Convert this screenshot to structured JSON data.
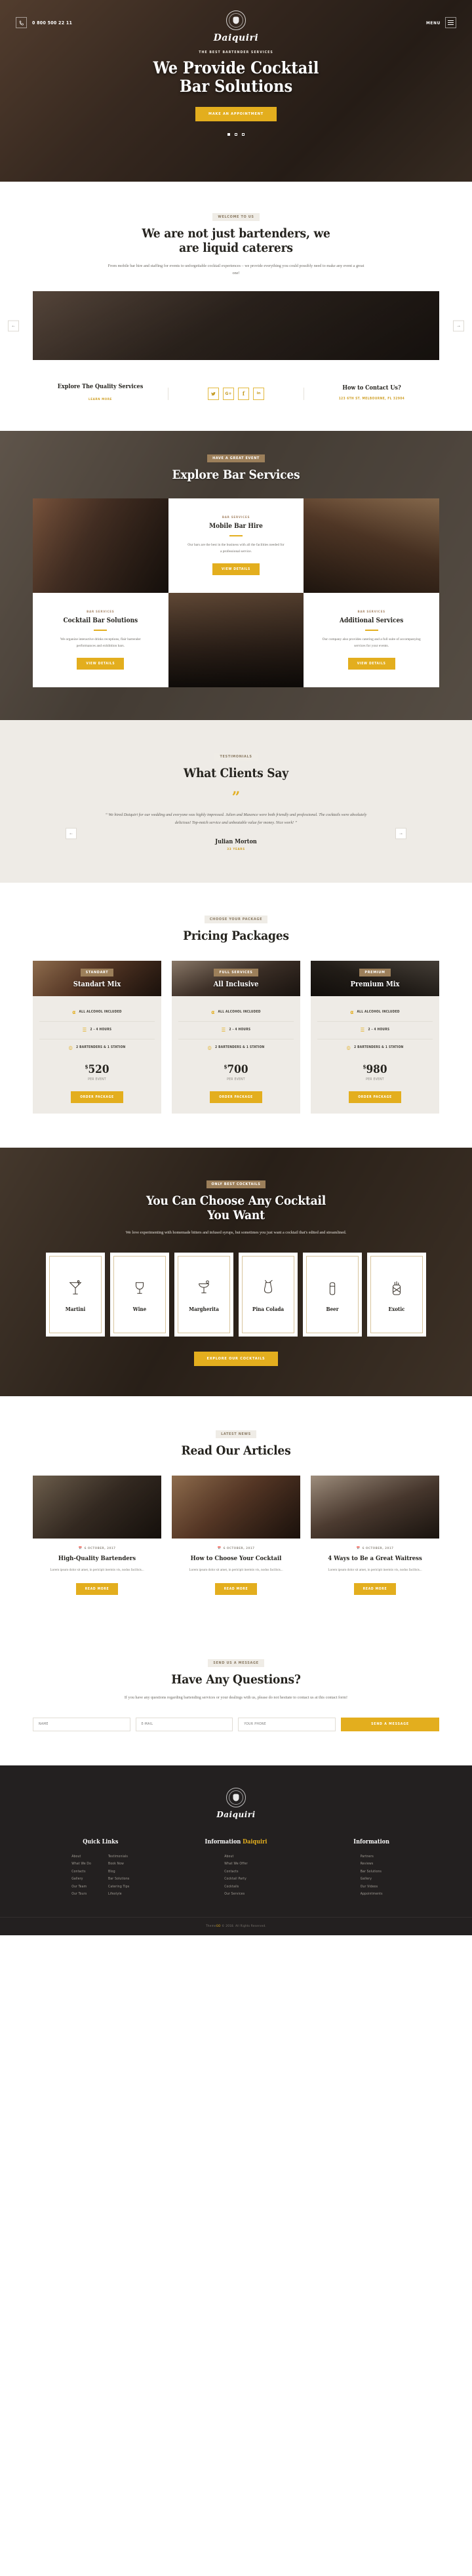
{
  "brand": {
    "name": "Daiquiri",
    "mark_icon": "shaker-emblem-icon"
  },
  "header": {
    "phone_icon": "phone-icon",
    "phone": "0 800 500 22 11",
    "menu_label": "MENU",
    "menu_icon": "hamburger-icon"
  },
  "hero": {
    "eyebrow": "THE BEST BARTENDER SERVICES",
    "title_line1": "We Provide Cocktail",
    "title_line2": "Bar Solutions",
    "cta": "MAKE AN APPOINTMENT",
    "slides": 3,
    "active_slide": 1
  },
  "about": {
    "badge": "WELCOME TO US",
    "title_line1": "We are not just bartenders, we",
    "title_line2": "are liquid caterers",
    "lead": "From mobile bar hire and staffing for events to unforgettable cocktail experiences – we provide everything you could possibly need to make any event a great one!",
    "prev_icon": "arrow-left-icon",
    "next_icon": "arrow-right-icon",
    "left_col": {
      "title": "Explore The Quality Services",
      "link": "LEARN MORE"
    },
    "socials": [
      {
        "name": "twitter-icon",
        "glyph": "✒"
      },
      {
        "name": "google-plus-icon",
        "glyph": "G+"
      },
      {
        "name": "facebook-icon",
        "glyph": "f"
      },
      {
        "name": "linkedin-icon",
        "glyph": "in"
      }
    ],
    "right_col": {
      "title": "How to Contact Us?",
      "address": "123 6TH ST. MELBOURNE, FL 32904"
    }
  },
  "services": {
    "badge": "HAVE A GREAT EVENT",
    "title": "Explore Bar Services",
    "cards": [
      {
        "eyebrow": "BAR SERVICES",
        "title": "Mobile Bar Hire",
        "text": "Our bars are the best in the business with all the facilities needed for a professional service.",
        "button": "VIEW DETAILS"
      },
      {
        "eyebrow": "BAR SERVICES",
        "title": "Cocktail Bar Solutions",
        "text": "We organize interactive drinks receptions, flair bartender performances and exhibition bars.",
        "button": "VIEW DETAILS"
      },
      {
        "eyebrow": "BAR SERVICES",
        "title": "Additional Services",
        "text": "Our company also provides catering and a full suite of accompanying services for your events.",
        "button": "VIEW DETAILS"
      }
    ]
  },
  "testimonials": {
    "badge": "TESTIMONIALS",
    "title": "What Clients Say",
    "quote_icon": "quote-icon",
    "quote": "“ We hired Daiquiri for our wedding and everyone was highly impressed. Julien and Maxence were both friendly and professional. The cocktails were absolutely delicious! Top-notch service and unbeatable value for money. Nice work! ”",
    "author": "Julian Morton",
    "author_meta": "33 YEARS",
    "prev_icon": "arrow-left-icon",
    "next_icon": "arrow-right-icon"
  },
  "pricing": {
    "badge": "CHOOSE YOUR PACKAGE",
    "title": "Pricing Packages",
    "packages": [
      {
        "tag": "STANDART",
        "name": "Standart Mix",
        "features": [
          {
            "icon": "bottle-icon",
            "glyph": "⚗",
            "label": "ALL ALCOHOL INCLUDED"
          },
          {
            "icon": "clipboard-icon",
            "glyph": "☰",
            "label": "2 - 4 HOURS"
          },
          {
            "icon": "badge-icon",
            "glyph": "◎",
            "label": "2 BARTENDERS & 1 STATION"
          }
        ],
        "currency": "$",
        "price": "520",
        "note": "PER EVENT",
        "button": "ORDER PACKAGE"
      },
      {
        "tag": "FULL SERVICES",
        "name": "All Inclusive",
        "features": [
          {
            "icon": "bottle-icon",
            "glyph": "⚗",
            "label": "ALL ALCOHOL INCLUDED"
          },
          {
            "icon": "clipboard-icon",
            "glyph": "☰",
            "label": "2 - 4 HOURS"
          },
          {
            "icon": "badge-icon",
            "glyph": "◎",
            "label": "2 BARTENDERS & 1 STATION"
          }
        ],
        "currency": "$",
        "price": "700",
        "note": "PER EVENT",
        "button": "ORDER PACKAGE"
      },
      {
        "tag": "PREMIUM",
        "name": "Premium Mix",
        "features": [
          {
            "icon": "bottle-icon",
            "glyph": "⚗",
            "label": "ALL ALCOHOL INCLUDED"
          },
          {
            "icon": "clipboard-icon",
            "glyph": "☰",
            "label": "2 - 4 HOURS"
          },
          {
            "icon": "badge-icon",
            "glyph": "◎",
            "label": "2 BARTENDERS & 1 STATION"
          }
        ],
        "currency": "$",
        "price": "980",
        "note": "PER EVENT",
        "button": "ORDER PACKAGE"
      }
    ]
  },
  "cocktails": {
    "badge": "ONLY BEST COCKTAILS",
    "title_line1": "You Can Choose Any Cocktail",
    "title_line2": "You Want",
    "lead": "We love experimenting with homemade bitters and infused syrups, but sometimes you just want a cocktail that's edited and streamlined.",
    "items": [
      {
        "icon": "martini-glass-icon",
        "label": "Martini"
      },
      {
        "icon": "wine-glass-icon",
        "label": "Wine"
      },
      {
        "icon": "margarita-glass-icon",
        "label": "Margherita"
      },
      {
        "icon": "pina-colada-glass-icon",
        "label": "Pina Colada"
      },
      {
        "icon": "beer-glass-icon",
        "label": "Beer"
      },
      {
        "icon": "exotic-pineapple-icon",
        "label": "Exotic"
      }
    ],
    "cta": "EXPLORE OUR COCKTAILS"
  },
  "blog": {
    "badge": "LATEST NEWS",
    "title": "Read Our Articles",
    "posts": [
      {
        "date_icon": "calendar-icon",
        "date": "6 OCTOBER, 2017",
        "title": "High-Quality Bartenders",
        "excerpt": "Lorem ipsum dolor sit amet, in pericipit inermis vis, nodus facilisis...",
        "button": "READ MORE"
      },
      {
        "date_icon": "calendar-icon",
        "date": "6 OCTOBER, 2017",
        "title": "How to Choose Your Cocktail",
        "excerpt": "Lorem ipsum dolor sit amet, in pericipit inermis vis, nodus facilisis...",
        "button": "READ MORE"
      },
      {
        "date_icon": "calendar-icon",
        "date": "6 OCTOBER, 2017",
        "title": "4 Ways to Be a Great Waitress",
        "excerpt": "Lorem ipsum dolor sit amet, in pericipit inermis vis, nodus facilisis...",
        "button": "READ MORE"
      }
    ]
  },
  "contact": {
    "badge": "SEND US A MESSAGE",
    "title": "Have Any Questions?",
    "lead": "If you have any questions regarding bartending services or your dealings with us, please do not hesitate to contact us at this contact form!",
    "fields": [
      {
        "name": "name-field",
        "placeholder": "NAME",
        "value": ""
      },
      {
        "name": "email-field",
        "placeholder": "E-MAIL",
        "value": ""
      },
      {
        "name": "phone-field",
        "placeholder": "YOUR PHONE",
        "value": ""
      }
    ],
    "submit": "SEND A MESSAGE"
  },
  "footer": {
    "brand": "Daiquiri",
    "columns": [
      {
        "title": "Quick Links",
        "title_gold": "",
        "lists": [
          [
            "About",
            "What We Do",
            "Contacts",
            "Gallery",
            "Our Team",
            "Our Tours"
          ],
          [
            "Testimonials",
            "Book Now",
            "Blog",
            "Bar Solutions",
            "Catering Tips",
            "Lifestyle"
          ]
        ]
      },
      {
        "title": "Information ",
        "title_gold": "Daiquiri",
        "lists": [
          [
            "About",
            "What We Offer",
            "Contacts",
            "Cocktail Party",
            "Cocktails",
            "Our Services"
          ],
          [
            "Partners",
            "Reviews",
            "Bar Solutions",
            "Gallery",
            "Our Videos",
            "Appointments"
          ]
        ]
      },
      {
        "title": "Information",
        "title_gold": "",
        "lists": [
          [
            "Partners",
            "Reviews",
            "Bar Solutions",
            "Gallery",
            "Our Videos",
            "Appointments"
          ]
        ]
      }
    ],
    "copyright_pre": "Theme",
    "copyright_brand": "GO",
    "copyright_post": " © 2018. All Rights Reserved."
  }
}
